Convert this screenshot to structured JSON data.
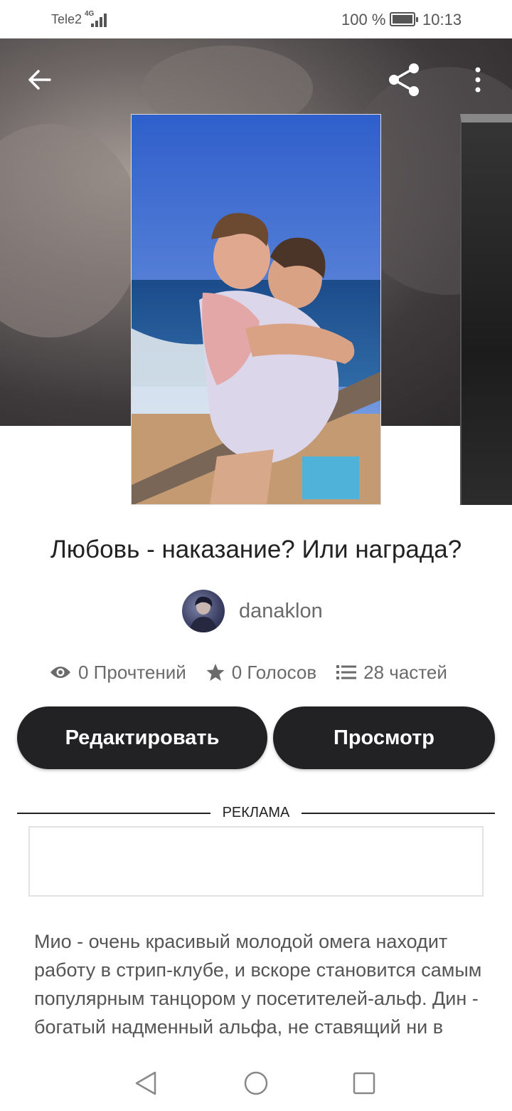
{
  "status_bar": {
    "carrier": "Tele2",
    "network": "4G",
    "battery_percent": "100 %",
    "time": "10:13"
  },
  "story": {
    "title": "Любовь - наказание? Или награда?",
    "author": "danaklon",
    "reads": "0 Прочтений",
    "votes": "0 Голосов",
    "parts": "28 частей",
    "description": "Мио - очень красивый молодой омега находит работу в стрип-клубе, и вскоре становится самым популярным танцором у посетителей-альф. Дин - богатый надменный альфа, не ставящий ни в грош омег..."
  },
  "buttons": {
    "edit_label": "Редактировать",
    "view_label": "Просмотр"
  },
  "ad": {
    "label": "РЕКЛАМА"
  },
  "icons": {
    "back": "arrow-left-icon",
    "share": "share-icon",
    "more": "more-vertical-icon",
    "reads": "eye-icon",
    "votes": "star-icon",
    "parts": "list-icon"
  },
  "colors": {
    "button_bg": "#222123",
    "button_text": "#ffffff",
    "muted_text": "#6a6a6a"
  }
}
